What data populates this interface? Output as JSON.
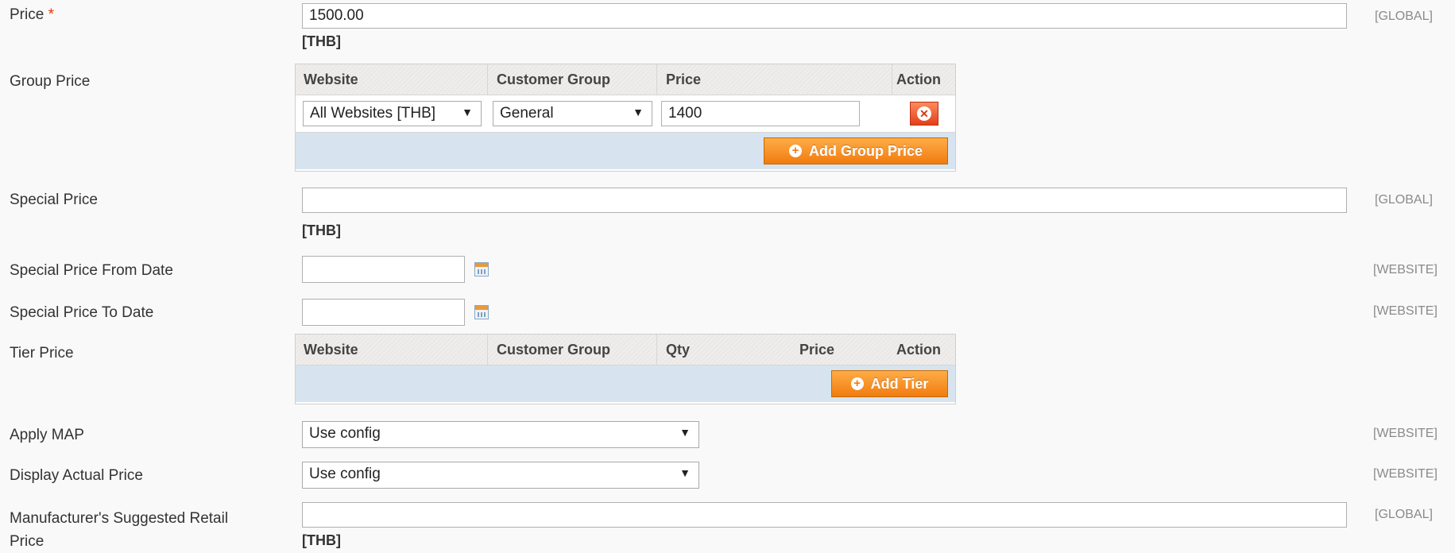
{
  "fields": {
    "price": {
      "label": "Price",
      "required_mark": "*",
      "value": "1500.00",
      "currency": "[THB]",
      "scope": "[GLOBAL]"
    },
    "group_price": {
      "label": "Group Price",
      "columns": [
        "Website",
        "Customer Group",
        "Price",
        "Action"
      ],
      "rows": [
        {
          "website": "All Websites [THB]",
          "customer_group": "General",
          "price": "1400"
        }
      ],
      "add_button": "Add Group Price"
    },
    "special_price": {
      "label": "Special Price",
      "value": "",
      "currency": "[THB]",
      "scope": "[GLOBAL]"
    },
    "special_from": {
      "label": "Special Price From Date",
      "value": "",
      "scope": "[WEBSITE]"
    },
    "special_to": {
      "label": "Special Price To Date",
      "value": "",
      "scope": "[WEBSITE]"
    },
    "tier_price": {
      "label": "Tier Price",
      "columns": [
        "Website",
        "Customer Group",
        "Qty",
        "Price",
        "Action"
      ],
      "add_button": "Add Tier"
    },
    "apply_map": {
      "label": "Apply MAP",
      "value": "Use config",
      "scope": "[WEBSITE]"
    },
    "display_actual": {
      "label": "Display Actual Price",
      "value": "Use config",
      "scope": "[WEBSITE]"
    },
    "msrp": {
      "label_line1": "Manufacturer's Suggested Retail",
      "label_line2": "Price",
      "value": "",
      "currency": "[THB]",
      "scope": "[GLOBAL]"
    }
  },
  "colors": {
    "accent_button": "#f07c10",
    "grid_footer": "#d7e4ef",
    "required": "#eb340a"
  },
  "icons": {
    "dropdown": "▼",
    "remove": "✕",
    "add": "+",
    "calendar": "calendar-icon"
  }
}
